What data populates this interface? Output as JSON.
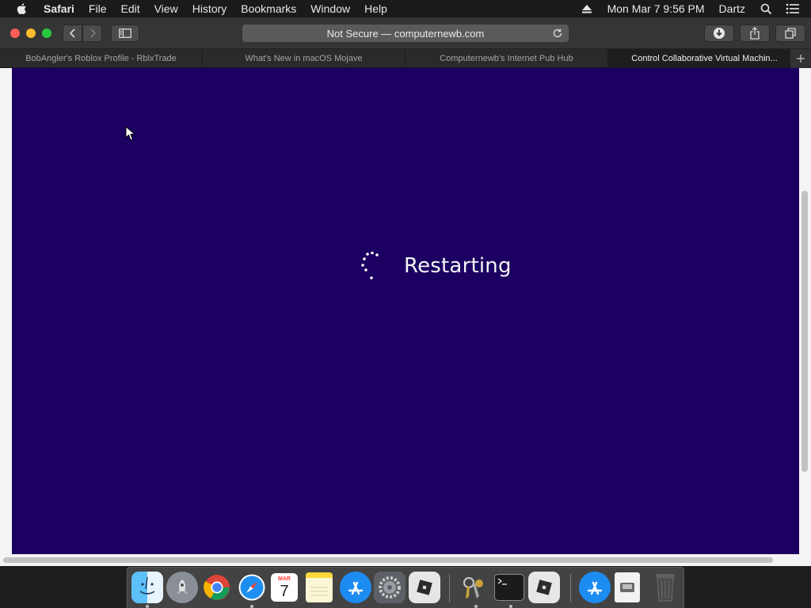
{
  "menubar": {
    "app_name": "Safari",
    "items": [
      "File",
      "Edit",
      "View",
      "History",
      "Bookmarks",
      "Window",
      "Help"
    ],
    "clock": "Mon Mar 7  9:56 PM",
    "user": "Dartz"
  },
  "toolbar": {
    "address_text": "Not Secure — computernewb.com"
  },
  "tabs": [
    {
      "label": "BobAngler's Roblox Profile - RblxTrade"
    },
    {
      "label": "What's New in macOS Mojave"
    },
    {
      "label": "Computernewb's Internet Pub Hub"
    },
    {
      "label": "Control Collaborative Virtual Machin..."
    }
  ],
  "vm": {
    "status_text": "Restarting",
    "background_color": "#1b0061"
  },
  "dock": {
    "calendar_month": "MAR",
    "calendar_day": "7",
    "items": [
      "finder-icon",
      "launchpad-icon",
      "chrome-icon",
      "safari-icon",
      "calendar-icon",
      "notes-icon",
      "app-store-icon",
      "system-preferences-icon",
      "roblox-icon",
      "keychain-access-icon",
      "terminal-icon",
      "roblox-studio-icon",
      "app-store-downloads-icon",
      "preview-document-icon",
      "trash-icon"
    ]
  }
}
